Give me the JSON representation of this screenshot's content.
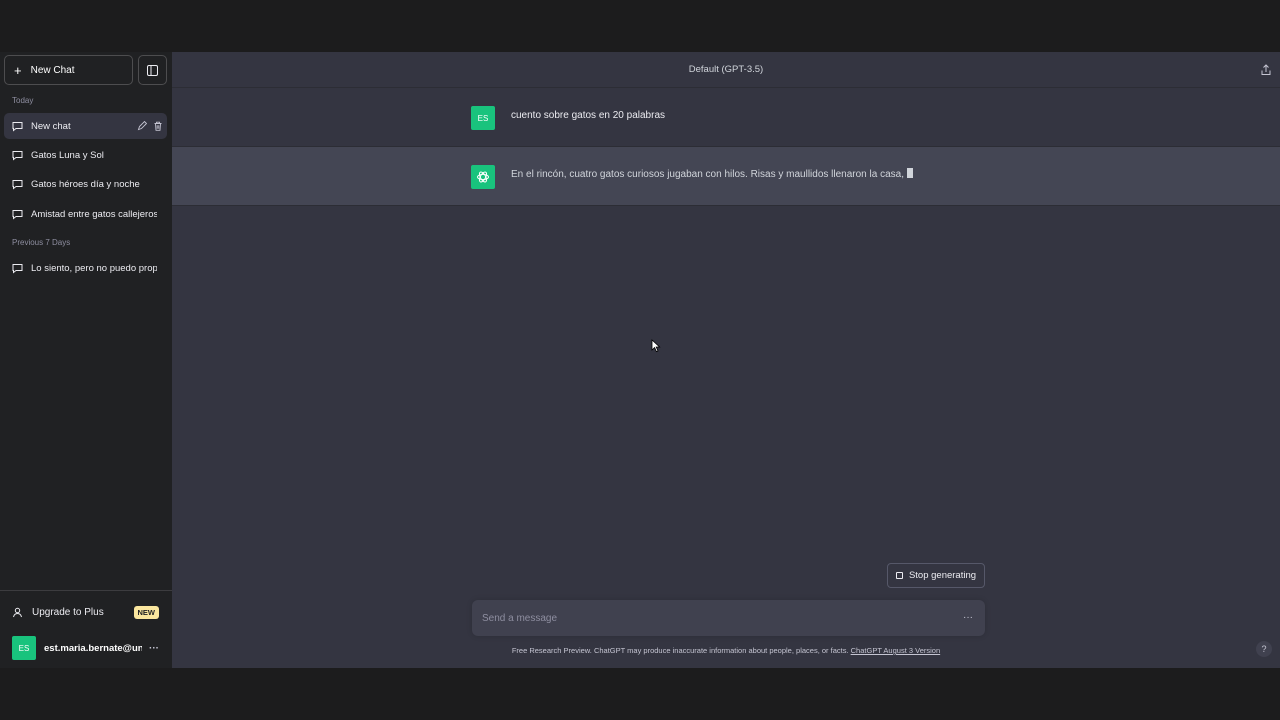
{
  "sidebar": {
    "new_chat_label": "New Chat",
    "sections": [
      {
        "label": "Today",
        "items": [
          {
            "label": "New chat",
            "active": true
          },
          {
            "label": "Gatos Luna y Sol",
            "active": false
          },
          {
            "label": "Gatos héroes día y noche",
            "active": false
          },
          {
            "label": "Amistad entre gatos callejeros",
            "active": false
          }
        ]
      },
      {
        "label": "Previous 7 Days",
        "items": [
          {
            "label": "Lo siento, pero no puedo prop",
            "active": false
          }
        ]
      }
    ],
    "upgrade_label": "Upgrade to Plus",
    "new_badge": "NEW",
    "account_initials": "ES",
    "account_email": "est.maria.bernate@uni",
    "account_more": "···"
  },
  "header": {
    "model_title": "Default (GPT-3.5)"
  },
  "conversation": {
    "user_initials": "ES",
    "user_message": "cuento sobre gatos en 20 palabras",
    "assistant_message": "En el rincón, cuatro gatos curiosos jugaban con hilos. Risas y maullidos llenaron la casa,"
  },
  "composer": {
    "stop_label": "Stop generating",
    "placeholder": "Send a message",
    "more": "···"
  },
  "footer": {
    "text": "Free Research Preview. ChatGPT may produce inaccurate information about people, places, or facts. ",
    "link": "ChatGPT August 3 Version",
    "help": "?"
  },
  "colors": {
    "accent_green": "#19c37d",
    "sidebar_bg": "#202123",
    "main_bg": "#343541",
    "assistant_row_bg": "#444654",
    "badge_bg": "#fae69e"
  }
}
